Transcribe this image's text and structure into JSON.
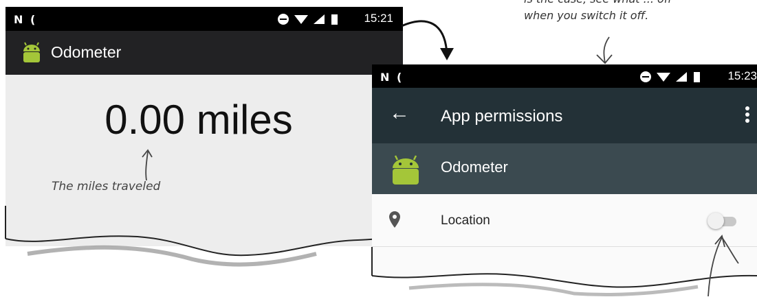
{
  "phone1": {
    "status": {
      "time": "15:21"
    },
    "appbar": {
      "title": "Odometer",
      "icon": "android-icon"
    },
    "content": {
      "reading": "0.00 miles"
    }
  },
  "annotations": {
    "miles": "The miles traveled",
    "top_line1": "is the case, see what ... off",
    "top_line2": "when you switch it off."
  },
  "phone2": {
    "status": {
      "time": "15:23"
    },
    "appbar": {
      "title": "App permissions",
      "back_icon": "back-arrow-icon",
      "menu_icon": "more-vert-icon"
    },
    "app": {
      "name": "Odometer",
      "icon": "android-icon"
    },
    "permissions": [
      {
        "label": "Location",
        "icon": "location-pin-icon",
        "enabled": false
      }
    ]
  },
  "colors": {
    "status_bar": "#000000",
    "phone1_appbar": "#222224",
    "phone2_appbar": "#233137",
    "phone2_header": "#3b4a50",
    "android_green": "#a4c639"
  }
}
